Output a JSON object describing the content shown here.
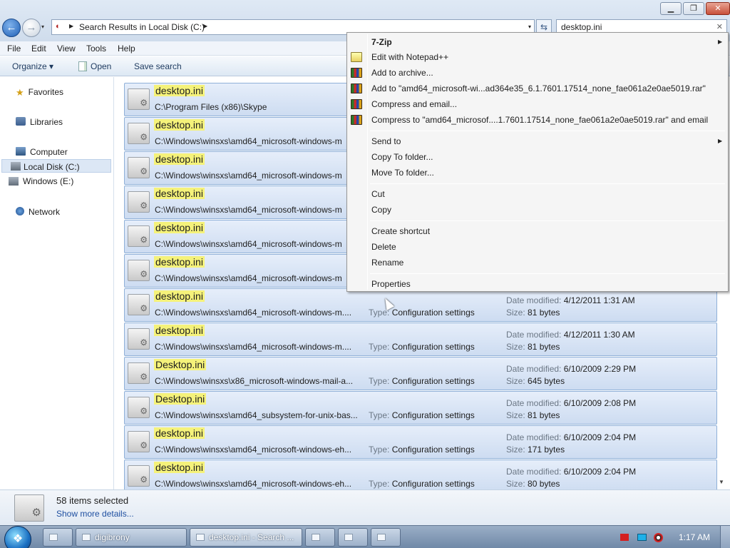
{
  "window": {
    "controls": {
      "minimize": "▁",
      "maximize": "❐",
      "close": "✕"
    },
    "address": "Search Results in Local Disk (C:)",
    "search_text": "desktop.ini",
    "nav_back_glyph": "←",
    "nav_forward_glyph": "→",
    "dropdown_glyph": "▾",
    "breadcrumb_arrow": "▶",
    "refresh_glyph": "⇆",
    "clear_glyph": "✕"
  },
  "menubar": {
    "file": "File",
    "edit": "Edit",
    "view": "View",
    "tools": "Tools",
    "help": "Help"
  },
  "commandbar": {
    "organize": "Organize ▾",
    "open": "Open",
    "save_search": "Save search"
  },
  "navigation": {
    "favorites": "Favorites",
    "libraries": "Libraries",
    "computer": "Computer",
    "local_disk": "Local Disk (C:)",
    "windows_drive": "Windows (E:)",
    "network": "Network",
    "favorites_icon": "★"
  },
  "results": [
    {
      "name": "desktop.ini",
      "path": "C:\\Program Files (x86)\\Skype",
      "type": "",
      "date": "",
      "size": ""
    },
    {
      "name": "desktop.ini",
      "path": "C:\\Windows\\winsxs\\amd64_microsoft-windows-m",
      "type": "",
      "date": "",
      "size": ""
    },
    {
      "name": "desktop.ini",
      "path": "C:\\Windows\\winsxs\\amd64_microsoft-windows-m",
      "type": "",
      "date": "",
      "size": ""
    },
    {
      "name": "desktop.ini",
      "path": "C:\\Windows\\winsxs\\amd64_microsoft-windows-m",
      "type": "",
      "date": "",
      "size": ""
    },
    {
      "name": "desktop.ini",
      "path": "C:\\Windows\\winsxs\\amd64_microsoft-windows-m",
      "type": "",
      "date": "",
      "size": ""
    },
    {
      "name": "desktop.ini",
      "path": "C:\\Windows\\winsxs\\amd64_microsoft-windows-m",
      "type": "",
      "date": "",
      "size": ""
    },
    {
      "name": "desktop.ini",
      "path": "C:\\Windows\\winsxs\\amd64_microsoft-windows-m....",
      "type": "Configuration settings",
      "date": "4/12/2011 1:31 AM",
      "size": "81 bytes"
    },
    {
      "name": "desktop.ini",
      "path": "C:\\Windows\\winsxs\\amd64_microsoft-windows-m....",
      "type": "Configuration settings",
      "date": "4/12/2011 1:30 AM",
      "size": "81 bytes"
    },
    {
      "name": "Desktop.ini",
      "path": "C:\\Windows\\winsxs\\x86_microsoft-windows-mail-a...",
      "type": "Configuration settings",
      "date": "6/10/2009 2:29 PM",
      "size": "645 bytes"
    },
    {
      "name": "Desktop.ini",
      "path": "C:\\Windows\\winsxs\\amd64_subsystem-for-unix-bas...",
      "type": "Configuration settings",
      "date": "6/10/2009 2:08 PM",
      "size": "81 bytes"
    },
    {
      "name": "desktop.ini",
      "path": "C:\\Windows\\winsxs\\amd64_microsoft-windows-eh...",
      "type": "Configuration settings",
      "date": "6/10/2009 2:04 PM",
      "size": "171 bytes"
    },
    {
      "name": "desktop.ini",
      "path": "C:\\Windows\\winsxs\\amd64_microsoft-windows-eh...",
      "type": "Configuration settings",
      "date": "6/10/2009 2:04 PM",
      "size": "80 bytes"
    }
  ],
  "labels": {
    "type": "Type:",
    "date_modified": "Date modified:",
    "size": "Size:",
    "gear_glyph": "⚙",
    "scroll_down": "▼"
  },
  "details": {
    "selected": "58 items selected",
    "show_more": "Show more details..."
  },
  "context_menu": {
    "seven_zip": "7-Zip",
    "edit_notepad": "Edit with Notepad++",
    "add_archive": "Add to archive...",
    "add_to_rar": "Add to \"amd64_microsoft-wi...ad364e35_6.1.7601.17514_none_fae061a2e0ae5019.rar\"",
    "compress_email": "Compress and email...",
    "compress_to_rar_email": "Compress to \"amd64_microsof....1.7601.17514_none_fae061a2e0ae5019.rar\" and email",
    "send_to": "Send to",
    "copy_to_folder": "Copy To folder...",
    "move_to_folder": "Move To folder...",
    "cut": "Cut",
    "copy": "Copy",
    "create_shortcut": "Create shortcut",
    "delete": "Delete",
    "rename": "Rename",
    "properties": "Properties",
    "submenu_arrow": "▶"
  },
  "taskbar": {
    "start_glyph": "❖",
    "digibrony": "digibrony",
    "desktop_search": "desktop.ini - Search ...",
    "clock": "1:17 AM"
  }
}
